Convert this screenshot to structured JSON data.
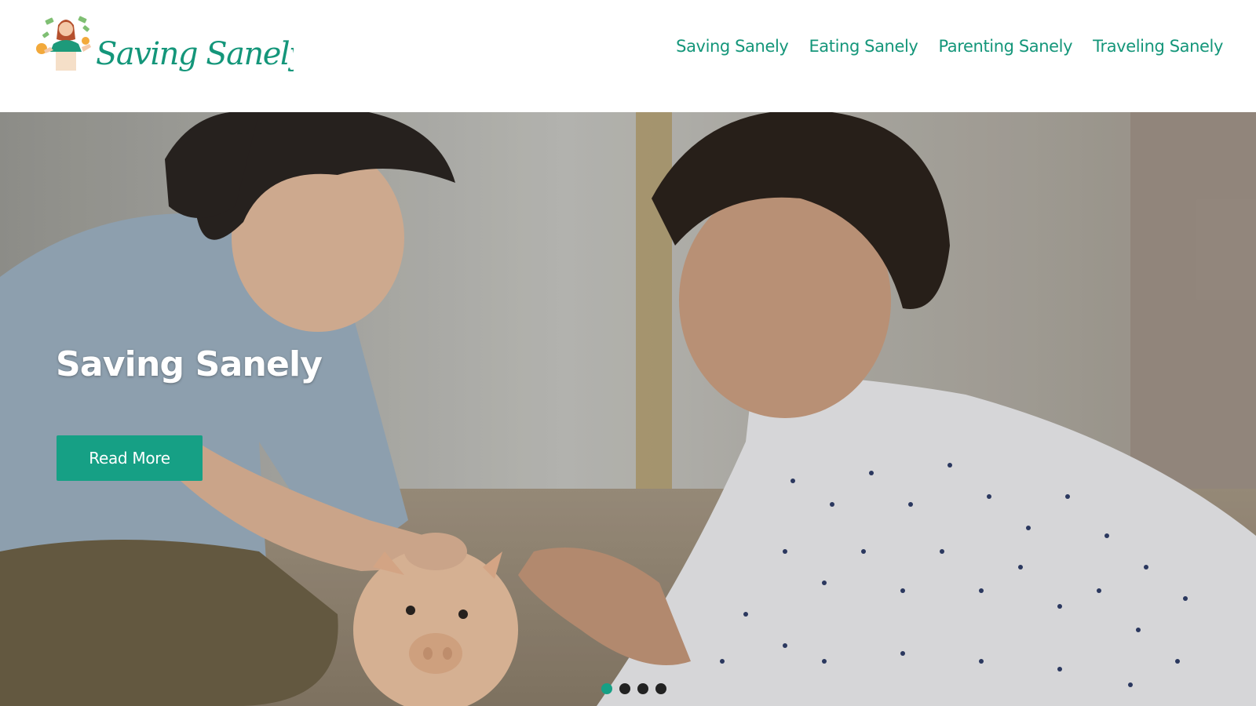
{
  "logo": {
    "text": "Saving Sanely",
    "accent_color": "#14967a"
  },
  "nav": {
    "items": [
      {
        "label": "Saving Sanely"
      },
      {
        "label": "Eating Sanely"
      },
      {
        "label": "Parenting Sanely"
      },
      {
        "label": "Traveling Sanely"
      }
    ]
  },
  "hero": {
    "title": "Saving Sanely",
    "button_label": "Read More",
    "button_color": "#16a085",
    "slides_total": 4,
    "active_slide": 1
  },
  "colors": {
    "brand": "#16a085",
    "dot_inactive": "#222222"
  }
}
